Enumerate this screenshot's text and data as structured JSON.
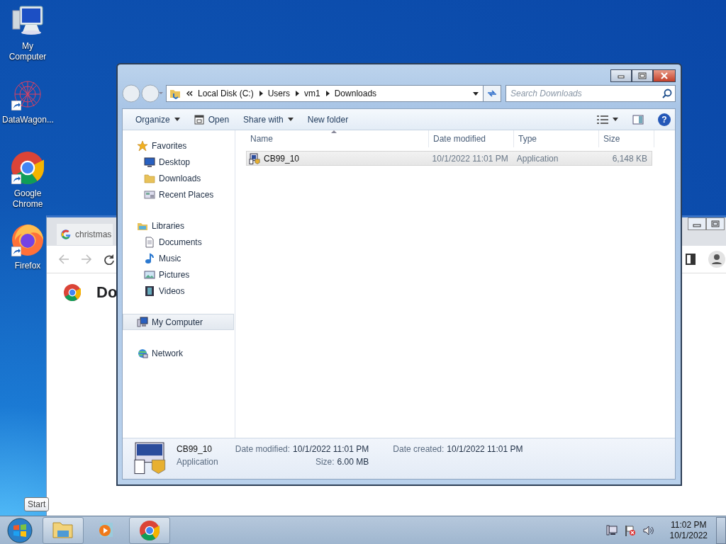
{
  "desktop_icons": [
    {
      "label": "My Computer",
      "kind": "computer",
      "shortcut": false
    },
    {
      "label": "DataWagon...",
      "kind": "datawagon",
      "shortcut": true
    },
    {
      "label": "Google Chrome",
      "kind": "chrome",
      "shortcut": true
    },
    {
      "label": "Firefox",
      "kind": "firefox",
      "shortcut": true
    }
  ],
  "browser_window": {
    "tab_title": "christmas",
    "heading": "Do"
  },
  "explorer": {
    "address": [
      "Local Disk (C:)",
      "Users",
      "vm1",
      "Downloads"
    ],
    "search": {
      "placeholder": "Search Downloads"
    },
    "toolbar": [
      {
        "label": "Organize",
        "dropdown": true,
        "kind": "plain"
      },
      {
        "label": "Open",
        "dropdown": false,
        "kind": "open"
      },
      {
        "label": "Share with",
        "dropdown": true,
        "kind": "plain"
      },
      {
        "label": "New folder",
        "dropdown": false,
        "kind": "plain"
      }
    ],
    "nav": [
      {
        "label": "Favorites",
        "kind": "star",
        "selected": false,
        "children": [
          {
            "label": "Desktop",
            "kind": "desktop",
            "selected": false
          },
          {
            "label": "Downloads",
            "kind": "folder",
            "selected": false
          },
          {
            "label": "Recent Places",
            "kind": "recent",
            "selected": false
          }
        ]
      },
      {
        "label": "Libraries",
        "kind": "library",
        "selected": false,
        "children": [
          {
            "label": "Documents",
            "kind": "document",
            "selected": false
          },
          {
            "label": "Music",
            "kind": "music",
            "selected": false
          },
          {
            "label": "Pictures",
            "kind": "picture",
            "selected": false
          },
          {
            "label": "Videos",
            "kind": "video",
            "selected": false
          }
        ]
      },
      {
        "label": "My Computer",
        "kind": "computer",
        "selected": true
      },
      {
        "label": "Network",
        "kind": "network",
        "selected": false
      }
    ],
    "help_glyph": "?",
    "columns": [
      "Name",
      "Date modified",
      "Type",
      "Size"
    ],
    "files": [
      {
        "name": "CB99_10",
        "date": "10/1/2022 11:01 PM",
        "type": "Application",
        "size": "6,148 KB",
        "selected": true
      }
    ],
    "details": {
      "name": "CB99_10",
      "type": "Application",
      "fields": [
        {
          "label": "Date modified:",
          "value": "10/1/2022 11:01 PM"
        },
        {
          "label": "Date created:",
          "value": "10/1/2022 11:01 PM"
        },
        {
          "label": "Size:",
          "value": "6.00 MB"
        }
      ]
    }
  },
  "tooltip": "Start",
  "taskbar": {
    "items": [
      {
        "kind": "explorer",
        "running": true
      },
      {
        "kind": "media",
        "running": false
      },
      {
        "kind": "chrome",
        "running": true
      }
    ],
    "time": "11:02 PM",
    "date": "10/1/2022"
  }
}
